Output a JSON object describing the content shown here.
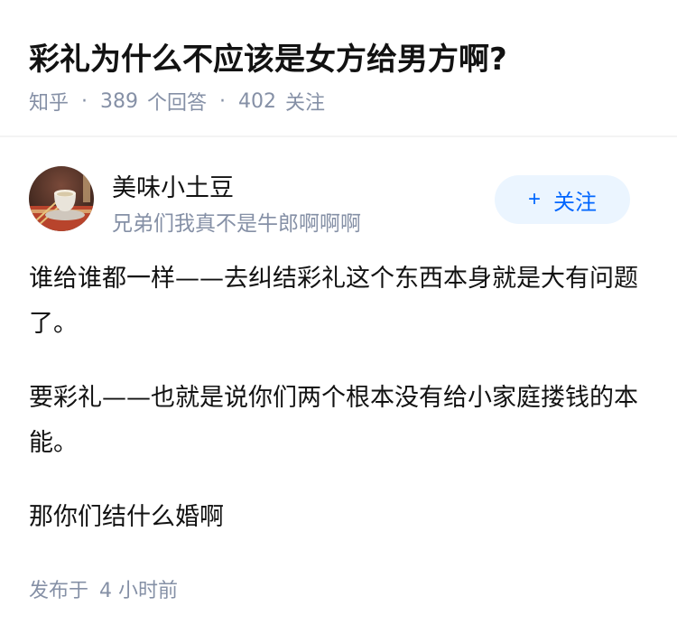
{
  "question": {
    "title": "彩礼为什么不应该是女方给男方啊?",
    "site": "知乎",
    "separator": "·",
    "answers_count": "389",
    "answers_label": "个回答",
    "followers_count": "402",
    "followers_label": "关注"
  },
  "author": {
    "name": "美味小土豆",
    "bio": "兄弟们我真不是牛郎啊啊啊",
    "avatar": "avatar-photo",
    "follow_plus": "+",
    "follow_label": "关注"
  },
  "answer": {
    "paragraphs": [
      "谁给谁都一样——去纠结彩礼这个东西本身就是大有问题了。",
      "要彩礼——也就是说你们两个根本没有给小家庭搂钱的本能。",
      "那你们结什么婚啊"
    ]
  },
  "footer": {
    "published_label": "发布于",
    "published_time": "4 小时前"
  },
  "colors": {
    "accent": "#0066ff",
    "accent_bg": "#ebf5ff",
    "meta": "#8590a6",
    "text": "#121212"
  }
}
